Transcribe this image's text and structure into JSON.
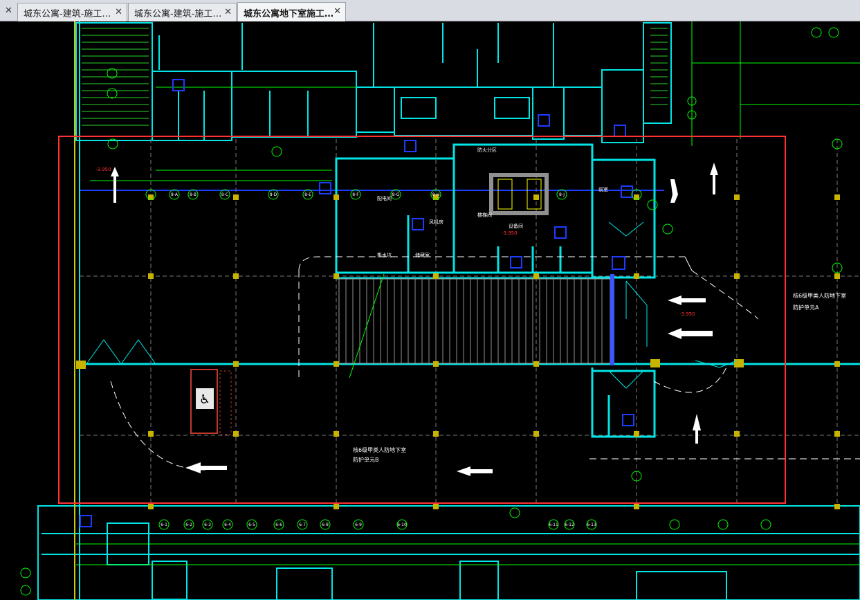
{
  "tabs": [
    {
      "label": "城东公寓-建筑-施工…",
      "active": false
    },
    {
      "label": "城东公寓-建筑-施工…",
      "active": false
    },
    {
      "label": "城东公寓地下室施工…",
      "active": true
    }
  ],
  "colors": {
    "background": "#000000",
    "wall_cyan": "#00e5e5",
    "grid_green": "#00ff00",
    "axis_yellow": "#ffff00",
    "axis_blue": "#1e3cff",
    "highlight_red": "#ff3333",
    "column_fill": "#c8b400",
    "text_white": "#ffffff"
  },
  "drawing": {
    "note_right_1": "核6级甲类人防地下室",
    "note_right_2": "防护单元A",
    "note_bottom_1": "核6级甲类人防地下室",
    "note_bottom_2": "防护单元B",
    "red_marks": [
      "-3.950",
      "-3.950",
      "-3.950"
    ],
    "grid_bubbles_top": [
      "8-A",
      "8-B",
      "8-C",
      "8-D",
      "8-E",
      "8-F",
      "8-G",
      "8-H",
      "8-J"
    ],
    "grid_bubbles_bottom": [
      "6-1",
      "6-2",
      "6-3",
      "6-4",
      "6-5",
      "6-6",
      "6-7",
      "6-8",
      "6-9",
      "6-10",
      "6-11",
      "6-12",
      "6-13"
    ],
    "room_labels": [
      "配电间",
      "风机房",
      "楼梯间",
      "前室",
      "集水坑",
      "储藏室",
      "设备间",
      "防火分区"
    ]
  }
}
